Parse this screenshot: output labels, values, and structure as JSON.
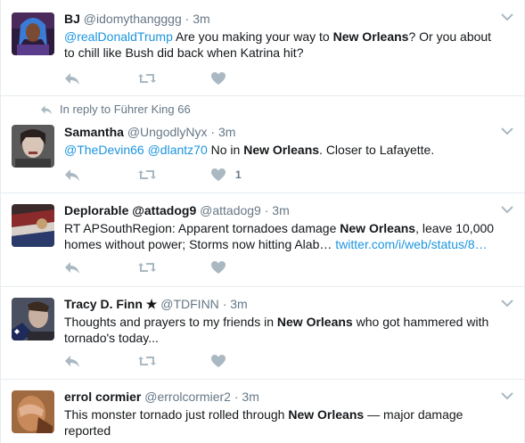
{
  "tweets": [
    {
      "fullname": "BJ",
      "username": "@idomythangggg",
      "sep": "·",
      "time": "3m",
      "text": [
        {
          "t": "@realDonaldTrump",
          "k": "mention"
        },
        {
          "t": " Are you making your way to ",
          "k": "plain"
        },
        {
          "t": "New Orleans",
          "k": "bold"
        },
        {
          "t": "? Or you about to chill like Bush did back when Katrina hit?",
          "k": "plain"
        }
      ],
      "like_count": ""
    },
    {
      "reply_context": "In reply to Führer King 66",
      "fullname": "Samantha",
      "username": "@UngodlyNyx",
      "sep": "·",
      "time": "3m",
      "text": [
        {
          "t": "@TheDevin66",
          "k": "mention"
        },
        {
          "t": " ",
          "k": "plain"
        },
        {
          "t": "@dlantz70",
          "k": "mention"
        },
        {
          "t": " No in ",
          "k": "plain"
        },
        {
          "t": "New Orleans",
          "k": "bold"
        },
        {
          "t": ". Closer to Lafayette.",
          "k": "plain"
        }
      ],
      "like_count": "1"
    },
    {
      "fullname": "Deplorable @attadog9",
      "username": "@attadog9",
      "sep": "·",
      "time": "3m",
      "text": [
        {
          "t": "RT APSouthRegion: Apparent tornadoes damage ",
          "k": "plain"
        },
        {
          "t": "New Orleans",
          "k": "bold"
        },
        {
          "t": ", leave 10,000 homes without power; Storms now hitting Alab… ",
          "k": "plain"
        },
        {
          "t": "twitter.com/i/web/status/8…",
          "k": "link"
        }
      ],
      "like_count": ""
    },
    {
      "fullname": "Tracy D. Finn ★",
      "username": "@TDFINN",
      "sep": "·",
      "time": "3m",
      "text": [
        {
          "t": "Thoughts and prayers to my friends in ",
          "k": "plain"
        },
        {
          "t": "New Orleans",
          "k": "bold"
        },
        {
          "t": " who got hammered with tornado's today...",
          "k": "plain"
        }
      ],
      "like_count": ""
    },
    {
      "fullname": "errol cormier",
      "username": "@errolcormier2",
      "sep": "·",
      "time": "3m",
      "text": [
        {
          "t": "This monster tornado just rolled through ",
          "k": "plain"
        },
        {
          "t": "New Orleans",
          "k": "bold"
        },
        {
          "t": " — major damage reported",
          "k": "plain"
        }
      ],
      "like_count": ""
    }
  ],
  "icons": {
    "reply": "reply-icon",
    "retweet": "retweet-icon",
    "like": "heart-icon",
    "caret": "chevron-down-icon"
  },
  "colors": {
    "link": "#1b95e0",
    "muted": "#657786",
    "icon": "#aab8c2",
    "border": "#e6ecf0"
  }
}
